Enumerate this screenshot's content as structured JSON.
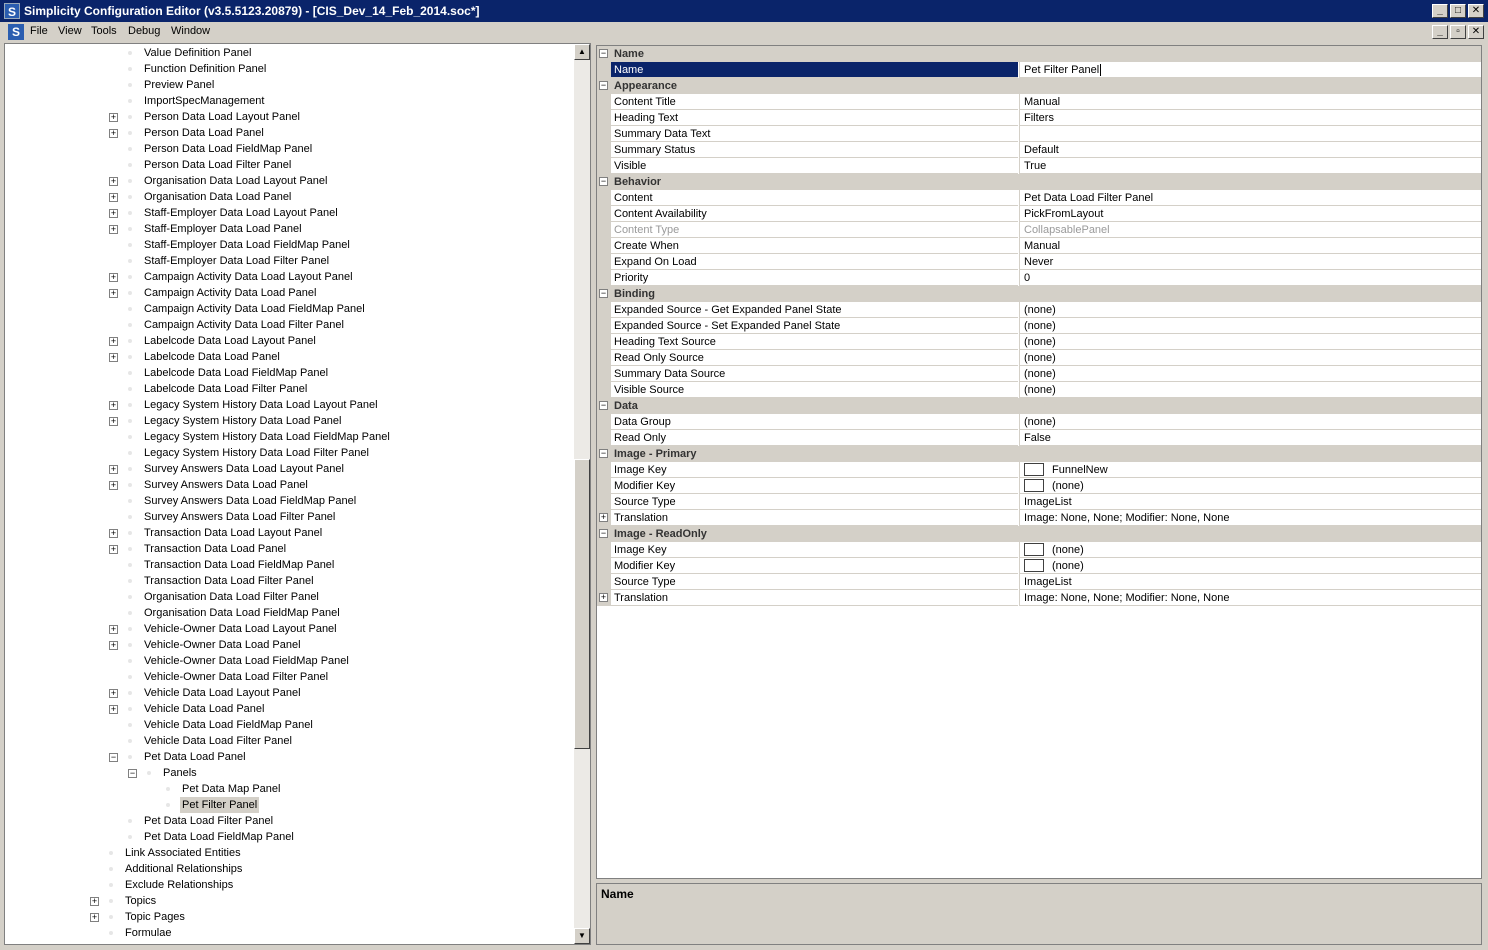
{
  "window": {
    "title": "Simplicity Configuration Editor (v3.5.5123.20879) - [CIS_Dev_14_Feb_2014.soc*]",
    "app_icon": "S",
    "controls": [
      "_",
      "□",
      "✕"
    ]
  },
  "menu": {
    "items": [
      "File",
      "View",
      "Tools",
      "Debug",
      "Window"
    ],
    "mdi_controls": [
      "_",
      "▫",
      "✕"
    ]
  },
  "tree": {
    "nodes": [
      {
        "label": "Value Definition Panel",
        "indent": 2,
        "expander": null
      },
      {
        "label": "Function Definition Panel",
        "indent": 2,
        "expander": null
      },
      {
        "label": "Preview Panel",
        "indent": 2,
        "expander": null
      },
      {
        "label": "ImportSpecManagement",
        "indent": 2,
        "expander": null
      },
      {
        "label": "Person Data Load Layout Panel",
        "indent": 2,
        "expander": "+"
      },
      {
        "label": "Person Data Load Panel",
        "indent": 2,
        "expander": "+"
      },
      {
        "label": "Person Data Load FieldMap Panel",
        "indent": 2,
        "expander": null
      },
      {
        "label": "Person Data Load Filter Panel",
        "indent": 2,
        "expander": null
      },
      {
        "label": "Organisation Data Load Layout Panel",
        "indent": 2,
        "expander": "+"
      },
      {
        "label": "Organisation Data Load Panel",
        "indent": 2,
        "expander": "+"
      },
      {
        "label": "Staff-Employer Data Load Layout Panel",
        "indent": 2,
        "expander": "+"
      },
      {
        "label": "Staff-Employer Data Load Panel",
        "indent": 2,
        "expander": "+"
      },
      {
        "label": "Staff-Employer Data Load FieldMap Panel",
        "indent": 2,
        "expander": null
      },
      {
        "label": "Staff-Employer Data Load Filter Panel",
        "indent": 2,
        "expander": null
      },
      {
        "label": "Campaign Activity Data Load Layout Panel",
        "indent": 2,
        "expander": "+"
      },
      {
        "label": "Campaign Activity Data Load Panel",
        "indent": 2,
        "expander": "+"
      },
      {
        "label": "Campaign Activity Data Load FieldMap Panel",
        "indent": 2,
        "expander": null
      },
      {
        "label": "Campaign Activity Data Load Filter Panel",
        "indent": 2,
        "expander": null
      },
      {
        "label": "Labelcode Data Load Layout Panel",
        "indent": 2,
        "expander": "+"
      },
      {
        "label": "Labelcode Data Load Panel",
        "indent": 2,
        "expander": "+"
      },
      {
        "label": "Labelcode Data Load FieldMap Panel",
        "indent": 2,
        "expander": null
      },
      {
        "label": "Labelcode Data Load Filter Panel",
        "indent": 2,
        "expander": null
      },
      {
        "label": "Legacy System History Data Load Layout Panel",
        "indent": 2,
        "expander": "+"
      },
      {
        "label": "Legacy System History Data Load Panel",
        "indent": 2,
        "expander": "+"
      },
      {
        "label": "Legacy System History Data Load FieldMap Panel",
        "indent": 2,
        "expander": null
      },
      {
        "label": "Legacy System History Data Load Filter Panel",
        "indent": 2,
        "expander": null
      },
      {
        "label": "Survey Answers Data Load Layout Panel",
        "indent": 2,
        "expander": "+"
      },
      {
        "label": "Survey Answers Data Load Panel",
        "indent": 2,
        "expander": "+"
      },
      {
        "label": "Survey Answers Data Load FieldMap Panel",
        "indent": 2,
        "expander": null
      },
      {
        "label": "Survey Answers Data Load Filter Panel",
        "indent": 2,
        "expander": null
      },
      {
        "label": "Transaction Data Load Layout Panel",
        "indent": 2,
        "expander": "+"
      },
      {
        "label": "Transaction Data Load Panel",
        "indent": 2,
        "expander": "+"
      },
      {
        "label": "Transaction Data Load FieldMap Panel",
        "indent": 2,
        "expander": null
      },
      {
        "label": "Transaction Data Load Filter Panel",
        "indent": 2,
        "expander": null
      },
      {
        "label": "Organisation Data Load Filter Panel",
        "indent": 2,
        "expander": null
      },
      {
        "label": "Organisation Data Load FieldMap Panel",
        "indent": 2,
        "expander": null
      },
      {
        "label": "Vehicle-Owner Data Load Layout Panel",
        "indent": 2,
        "expander": "+"
      },
      {
        "label": "Vehicle-Owner Data Load Panel",
        "indent": 2,
        "expander": "+"
      },
      {
        "label": "Vehicle-Owner Data Load FieldMap Panel",
        "indent": 2,
        "expander": null
      },
      {
        "label": "Vehicle-Owner Data Load Filter Panel",
        "indent": 2,
        "expander": null
      },
      {
        "label": "Vehicle Data Load Layout Panel",
        "indent": 2,
        "expander": "+"
      },
      {
        "label": "Vehicle Data Load Panel",
        "indent": 2,
        "expander": "+"
      },
      {
        "label": "Vehicle Data Load FieldMap Panel",
        "indent": 2,
        "expander": null
      },
      {
        "label": "Vehicle Data Load Filter Panel",
        "indent": 2,
        "expander": null
      },
      {
        "label": "Pet Data Load Panel",
        "indent": 2,
        "expander": "-"
      },
      {
        "label": "Panels",
        "indent": 3,
        "expander": "-"
      },
      {
        "label": "Pet Data Map Panel",
        "indent": 4,
        "expander": null
      },
      {
        "label": "Pet Filter Panel",
        "indent": 4,
        "expander": null,
        "selected": true
      },
      {
        "label": "Pet Data Load Filter Panel",
        "indent": 2,
        "expander": null
      },
      {
        "label": "Pet Data Load FieldMap Panel",
        "indent": 2,
        "expander": null
      },
      {
        "label": "Link Associated Entities",
        "indent": 1,
        "expander": null
      },
      {
        "label": "Additional Relationships",
        "indent": 1,
        "expander": null
      },
      {
        "label": "Exclude Relationships",
        "indent": 1,
        "expander": null
      },
      {
        "label": "Topics",
        "indent": 1,
        "expander": "+"
      },
      {
        "label": "Topic Pages",
        "indent": 1,
        "expander": "+"
      },
      {
        "label": "Formulae",
        "indent": 1,
        "expander": null
      }
    ]
  },
  "properties": {
    "rows": [
      {
        "type": "cat",
        "name": "Name"
      },
      {
        "type": "prop",
        "name": "Name",
        "value": "Pet Filter Panel",
        "selected": true
      },
      {
        "type": "cat",
        "name": "Appearance"
      },
      {
        "type": "prop",
        "name": "Content Title",
        "value": "Manual"
      },
      {
        "type": "prop",
        "name": "Heading Text",
        "value": "Filters"
      },
      {
        "type": "prop",
        "name": "Summary Data Text",
        "value": ""
      },
      {
        "type": "prop",
        "name": "Summary Status",
        "value": "Default"
      },
      {
        "type": "prop",
        "name": "Visible",
        "value": "True"
      },
      {
        "type": "cat",
        "name": "Behavior"
      },
      {
        "type": "prop",
        "name": "Content",
        "value": "Pet Data Load Filter Panel"
      },
      {
        "type": "prop",
        "name": "Content Availability",
        "value": "PickFromLayout"
      },
      {
        "type": "prop",
        "name": "Content Type",
        "value": "CollapsablePanel",
        "disabled": true
      },
      {
        "type": "prop",
        "name": "Create When",
        "value": "Manual"
      },
      {
        "type": "prop",
        "name": "Expand On Load",
        "value": "Never"
      },
      {
        "type": "prop",
        "name": "Priority",
        "value": "0"
      },
      {
        "type": "cat",
        "name": "Binding"
      },
      {
        "type": "prop",
        "name": "Expanded Source - Get Expanded Panel State",
        "value": "(none)"
      },
      {
        "type": "prop",
        "name": "Expanded Source - Set Expanded Panel State",
        "value": "(none)"
      },
      {
        "type": "prop",
        "name": "Heading Text Source",
        "value": "(none)"
      },
      {
        "type": "prop",
        "name": "Read Only Source",
        "value": "(none)"
      },
      {
        "type": "prop",
        "name": "Summary Data Source",
        "value": "(none)"
      },
      {
        "type": "prop",
        "name": "Visible Source",
        "value": "(none)"
      },
      {
        "type": "cat",
        "name": "Data"
      },
      {
        "type": "prop",
        "name": "Data Group",
        "value": "(none)"
      },
      {
        "type": "prop",
        "name": "Read Only",
        "value": "False"
      },
      {
        "type": "cat",
        "name": "Image - Primary"
      },
      {
        "type": "prop",
        "name": "Image Key",
        "value": "FunnelNew",
        "swatch": true
      },
      {
        "type": "prop",
        "name": "Modifier Key",
        "value": "(none)",
        "swatch": true
      },
      {
        "type": "prop",
        "name": "Source Type",
        "value": "ImageList"
      },
      {
        "type": "prop",
        "name": "Translation",
        "value": "Image: None, None; Modifier: None, None",
        "expander": "+"
      },
      {
        "type": "cat",
        "name": "Image - ReadOnly"
      },
      {
        "type": "prop",
        "name": "Image Key",
        "value": "(none)",
        "swatch": true
      },
      {
        "type": "prop",
        "name": "Modifier Key",
        "value": "(none)",
        "swatch": true
      },
      {
        "type": "prop",
        "name": "Source Type",
        "value": "ImageList"
      },
      {
        "type": "prop",
        "name": "Translation",
        "value": "Image: None, None; Modifier: None, None",
        "expander": "+"
      }
    ]
  },
  "description": {
    "title": "Name"
  },
  "colors": {
    "titlebar": "#0a246a",
    "selection": "#0a246a",
    "chrome": "#d4d0c8"
  }
}
